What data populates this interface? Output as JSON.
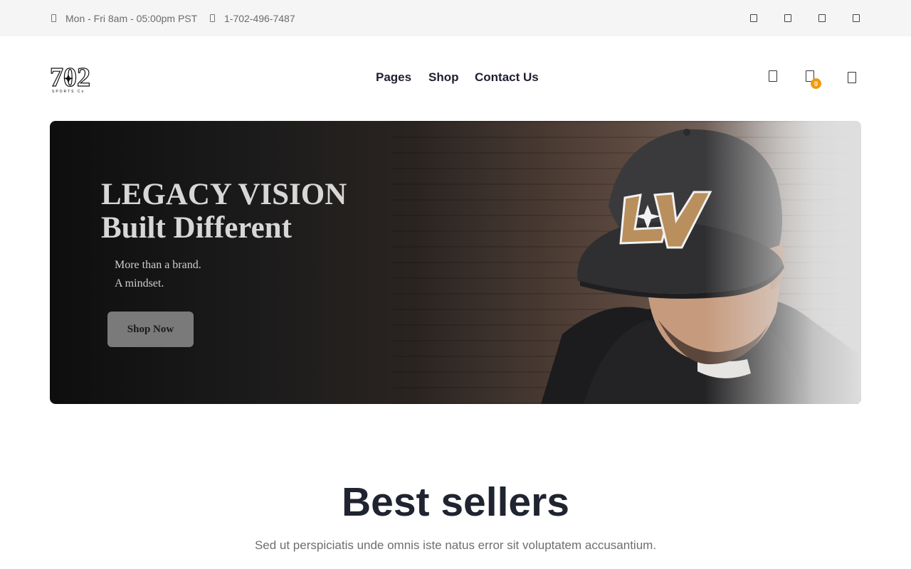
{
  "topbar": {
    "hours": "Mon - Fri 8am - 05:00pm PST",
    "phone": "1-702-496-7487",
    "social_icons": [
      "facebook-icon",
      "twitter-icon",
      "instagram-icon",
      "youtube-icon"
    ]
  },
  "header": {
    "logo_text": "702",
    "logo_caption": "SPORTS Co",
    "nav": [
      "Pages",
      "Shop",
      "Contact Us"
    ],
    "icons": [
      "user-icon",
      "cart-icon",
      "menu-icon"
    ],
    "cart_count": "0",
    "badge_color": "#f29a10"
  },
  "hero": {
    "title_line1": "LEGACY VISION",
    "title_line2": "Built Different",
    "subtitle_line1": "More than a brand.",
    "subtitle_line2": "A mindset.",
    "cta": "Shop Now",
    "cap_logo": "LV"
  },
  "best_sellers": {
    "title": "Best sellers",
    "subtitle": "Sed ut perspiciatis unde omnis iste natus error sit voluptatem accusantium."
  }
}
